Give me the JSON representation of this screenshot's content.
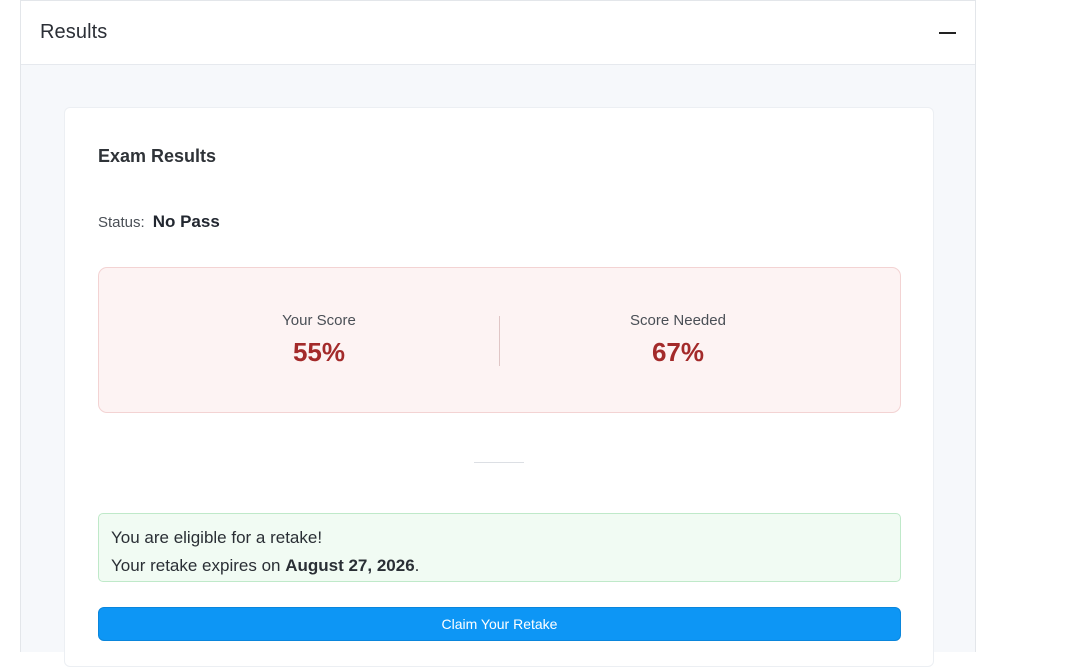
{
  "panel": {
    "title": "Results",
    "collapse_icon": "minus-icon"
  },
  "card": {
    "title": "Exam Results",
    "status_label": "Status:",
    "status_value": "No Pass"
  },
  "scores": {
    "your_score_label": "Your Score",
    "your_score_value": "55%",
    "needed_label": "Score Needed",
    "needed_value": "67%"
  },
  "retake": {
    "eligible_text": "You are eligible for a retake!",
    "expires_prefix": "Your retake expires on ",
    "expires_date": "August 27, 2026",
    "expires_suffix": ".",
    "button_label": "Claim Your Retake"
  },
  "colors": {
    "score_value": "#a32a2a",
    "score_box_bg": "#fdf3f3",
    "retake_box_bg": "#f1fbf3",
    "button_bg": "#0d96f5"
  }
}
